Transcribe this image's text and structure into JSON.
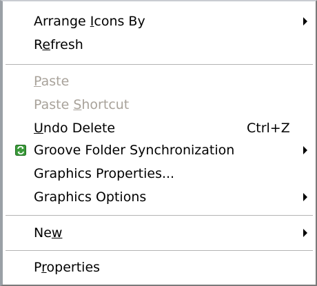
{
  "menu": {
    "items": [
      {
        "pre": "Arrange ",
        "key": "I",
        "post": "cons By",
        "submenu": true,
        "enabled": true
      },
      {
        "pre": "R",
        "key": "e",
        "post": "fresh",
        "submenu": false,
        "enabled": true
      },
      {
        "pre": "",
        "key": "P",
        "post": "aste",
        "submenu": false,
        "enabled": false
      },
      {
        "pre": "Paste ",
        "key": "S",
        "post": "hortcut",
        "submenu": false,
        "enabled": false
      },
      {
        "pre": "",
        "key": "U",
        "post": "ndo Delete",
        "shortcut": "Ctrl+Z",
        "submenu": false,
        "enabled": true
      },
      {
        "pre": "Groove Folder Synchronization",
        "key": "",
        "post": "",
        "submenu": true,
        "enabled": true,
        "icon": "groove-sync-icon"
      },
      {
        "pre": "Graphics Properties...",
        "key": "",
        "post": "",
        "submenu": false,
        "enabled": true
      },
      {
        "pre": "Graphics Options",
        "key": "",
        "post": "",
        "submenu": true,
        "enabled": true
      },
      {
        "pre": "Ne",
        "key": "w",
        "post": "",
        "submenu": true,
        "enabled": true
      },
      {
        "pre": "P",
        "key": "r",
        "post": "operties",
        "submenu": false,
        "enabled": true
      }
    ]
  },
  "colors": {
    "text": "#000000",
    "disabled_text": "#a8a29a",
    "background": "#ffffff",
    "separator": "#b3b3b3",
    "icon_green": "#3a9a3a"
  }
}
